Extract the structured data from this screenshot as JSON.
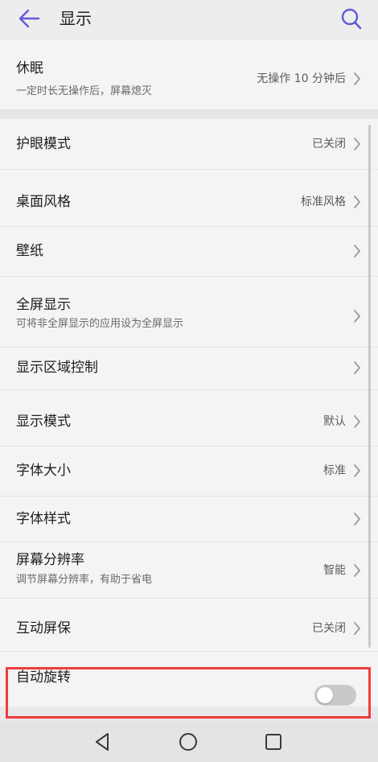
{
  "header": {
    "title": "显示",
    "back_icon": "arrow-left-icon",
    "search_icon": "search-icon",
    "accent_color": "#5f5bd6"
  },
  "groups": [
    {
      "items": [
        {
          "title": "休眠",
          "subtitle": "一定时长无操作后，屏幕熄灭",
          "value": "无操作 10 分钟后"
        }
      ]
    },
    {
      "items": [
        {
          "title": "护眼模式",
          "value": "已关闭"
        },
        {
          "title": "桌面风格",
          "value": "标准风格"
        },
        {
          "title": "壁纸",
          "value": ""
        },
        {
          "title": "全屏显示",
          "subtitle": "可将非全屏显示的应用设为全屏显示",
          "value": ""
        },
        {
          "title": "显示区域控制",
          "value": ""
        },
        {
          "title": "显示模式",
          "value": "默认"
        },
        {
          "title": "字体大小",
          "value": "标准"
        },
        {
          "title": "字体样式",
          "value": ""
        },
        {
          "title": "屏幕分辨率",
          "subtitle": "调节屏幕分辨率，有助于省电",
          "value": "智能"
        },
        {
          "title": "互动屏保",
          "value": "已关闭"
        },
        {
          "title": "自动旋转",
          "toggle_on": false
        }
      ]
    }
  ],
  "highlight_color": "#ef3b3b",
  "navigation": [
    "back-triangle-icon",
    "home-circle-icon",
    "recents-square-icon"
  ]
}
